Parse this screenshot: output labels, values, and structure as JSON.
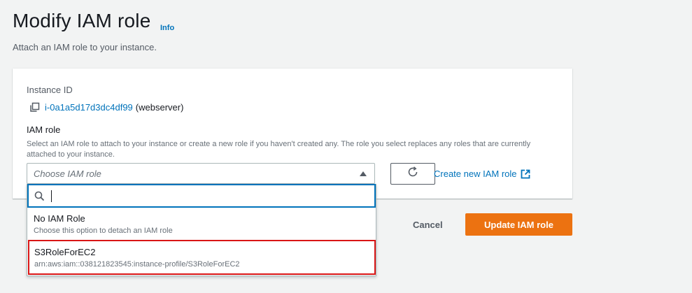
{
  "header": {
    "title": "Modify IAM role",
    "info_label": "Info",
    "subtitle": "Attach an IAM role to your instance."
  },
  "instance": {
    "label": "Instance ID",
    "id": "i-0a1a5d17d3dc4df99",
    "name": "(webserver)"
  },
  "iam_role": {
    "label": "IAM role",
    "description": "Select an IAM role to attach to your instance or create a new role if you haven't created any. The role you select replaces any roles that are currently attached to your instance.",
    "select_placeholder": "Choose IAM role",
    "create_link": "Create new IAM role",
    "search_value": "",
    "options": [
      {
        "title": "No IAM Role",
        "subtitle": "Choose this option to detach an IAM role"
      },
      {
        "title": "S3RoleForEC2",
        "subtitle": "arn:aws:iam::038121823545:instance-profile/S3RoleForEC2"
      }
    ]
  },
  "actions": {
    "cancel_label": "Cancel",
    "update_label": "Update IAM role"
  },
  "icons": {
    "copy": "copy-icon",
    "refresh": "refresh-icon",
    "external": "external-link-icon",
    "search": "search-icon",
    "caret": "caret-up-icon"
  },
  "colors": {
    "link": "#0073bb",
    "primary_button": "#ec7211",
    "highlight_border": "#d91515",
    "focus_border": "#0073bb"
  }
}
